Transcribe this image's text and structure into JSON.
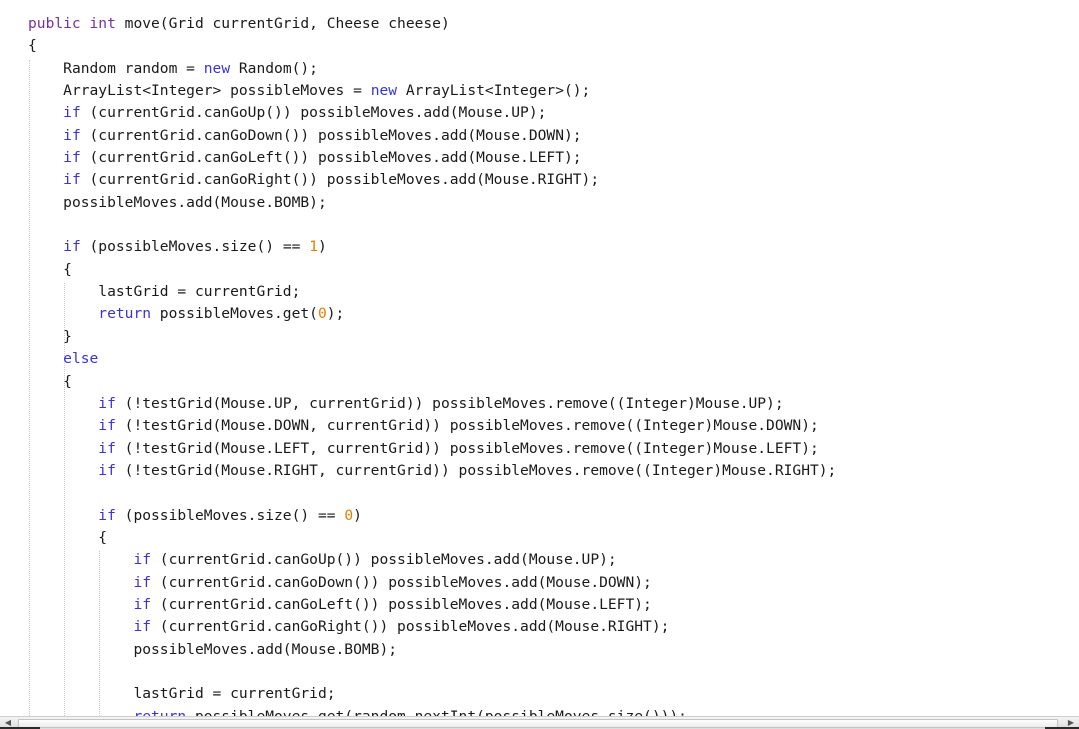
{
  "editor": {
    "language": "java",
    "background_color": "#ffffff",
    "text_color": "#1a1a1a",
    "keyword_color": "#3a34d2",
    "modifier_color": "#7a2fa0",
    "number_color": "#e08000",
    "indent_guide_color": "#c9c9c9",
    "font_size_px": "14.6",
    "line_height_px": "22.35"
  },
  "scrollbar": {
    "orientation": "horizontal",
    "left_arrow": "◀",
    "right_arrow": "▶"
  },
  "code": {
    "lines": [
      {
        "indent": 0,
        "tokens": [
          {
            "t": "public",
            "c": "mod"
          },
          {
            "t": " ",
            "c": "plain"
          },
          {
            "t": "int",
            "c": "mod"
          },
          {
            "t": " move(Grid currentGrid, Cheese cheese)",
            "c": "plain"
          }
        ]
      },
      {
        "indent": 0,
        "tokens": [
          {
            "t": "{",
            "c": "plain"
          }
        ]
      },
      {
        "indent": 1,
        "tokens": [
          {
            "t": "Random random = ",
            "c": "plain"
          },
          {
            "t": "new",
            "c": "kw"
          },
          {
            "t": " Random();",
            "c": "plain"
          }
        ]
      },
      {
        "indent": 1,
        "tokens": [
          {
            "t": "ArrayList<Integer> possibleMoves = ",
            "c": "plain"
          },
          {
            "t": "new",
            "c": "kw"
          },
          {
            "t": " ArrayList<Integer>();",
            "c": "plain"
          }
        ]
      },
      {
        "indent": 1,
        "tokens": [
          {
            "t": "if",
            "c": "kw"
          },
          {
            "t": " (currentGrid.canGoUp()) possibleMoves.add(Mouse.UP);",
            "c": "plain"
          }
        ]
      },
      {
        "indent": 1,
        "tokens": [
          {
            "t": "if",
            "c": "kw"
          },
          {
            "t": " (currentGrid.canGoDown()) possibleMoves.add(Mouse.DOWN);",
            "c": "plain"
          }
        ]
      },
      {
        "indent": 1,
        "tokens": [
          {
            "t": "if",
            "c": "kw"
          },
          {
            "t": " (currentGrid.canGoLeft()) possibleMoves.add(Mouse.LEFT);",
            "c": "plain"
          }
        ]
      },
      {
        "indent": 1,
        "tokens": [
          {
            "t": "if",
            "c": "kw"
          },
          {
            "t": " (currentGrid.canGoRight()) possibleMoves.add(Mouse.RIGHT);",
            "c": "plain"
          }
        ]
      },
      {
        "indent": 1,
        "tokens": [
          {
            "t": "possibleMoves.add(Mouse.BOMB);",
            "c": "plain"
          }
        ]
      },
      {
        "indent": 1,
        "tokens": []
      },
      {
        "indent": 1,
        "tokens": [
          {
            "t": "if",
            "c": "kw"
          },
          {
            "t": " (possibleMoves.size() == ",
            "c": "plain"
          },
          {
            "t": "1",
            "c": "num"
          },
          {
            "t": ")",
            "c": "plain"
          }
        ]
      },
      {
        "indent": 1,
        "tokens": [
          {
            "t": "{",
            "c": "plain"
          }
        ]
      },
      {
        "indent": 2,
        "tokens": [
          {
            "t": "lastGrid = currentGrid;",
            "c": "plain"
          }
        ]
      },
      {
        "indent": 2,
        "tokens": [
          {
            "t": "return",
            "c": "kw"
          },
          {
            "t": " possibleMoves.get(",
            "c": "plain"
          },
          {
            "t": "0",
            "c": "num"
          },
          {
            "t": ");",
            "c": "plain"
          }
        ]
      },
      {
        "indent": 1,
        "tokens": [
          {
            "t": "}",
            "c": "plain"
          }
        ]
      },
      {
        "indent": 1,
        "tokens": [
          {
            "t": "else",
            "c": "kw"
          }
        ]
      },
      {
        "indent": 1,
        "tokens": [
          {
            "t": "{",
            "c": "plain"
          }
        ]
      },
      {
        "indent": 2,
        "tokens": [
          {
            "t": "if",
            "c": "kw"
          },
          {
            "t": " (!testGrid(Mouse.UP, currentGrid)) possibleMoves.remove((Integer)Mouse.UP);",
            "c": "plain"
          }
        ]
      },
      {
        "indent": 2,
        "tokens": [
          {
            "t": "if",
            "c": "kw"
          },
          {
            "t": " (!testGrid(Mouse.DOWN, currentGrid)) possibleMoves.remove((Integer)Mouse.DOWN);",
            "c": "plain"
          }
        ]
      },
      {
        "indent": 2,
        "tokens": [
          {
            "t": "if",
            "c": "kw"
          },
          {
            "t": " (!testGrid(Mouse.LEFT, currentGrid)) possibleMoves.remove((Integer)Mouse.LEFT);",
            "c": "plain"
          }
        ]
      },
      {
        "indent": 2,
        "tokens": [
          {
            "t": "if",
            "c": "kw"
          },
          {
            "t": " (!testGrid(Mouse.RIGHT, currentGrid)) possibleMoves.remove((Integer)Mouse.RIGHT);",
            "c": "plain"
          }
        ]
      },
      {
        "indent": 2,
        "tokens": []
      },
      {
        "indent": 2,
        "tokens": [
          {
            "t": "if",
            "c": "kw"
          },
          {
            "t": " (possibleMoves.size() == ",
            "c": "plain"
          },
          {
            "t": "0",
            "c": "num"
          },
          {
            "t": ")",
            "c": "plain"
          }
        ]
      },
      {
        "indent": 2,
        "tokens": [
          {
            "t": "{",
            "c": "plain"
          }
        ]
      },
      {
        "indent": 3,
        "tokens": [
          {
            "t": "if",
            "c": "kw"
          },
          {
            "t": " (currentGrid.canGoUp()) possibleMoves.add(Mouse.UP);",
            "c": "plain"
          }
        ]
      },
      {
        "indent": 3,
        "tokens": [
          {
            "t": "if",
            "c": "kw"
          },
          {
            "t": " (currentGrid.canGoDown()) possibleMoves.add(Mouse.DOWN);",
            "c": "plain"
          }
        ]
      },
      {
        "indent": 3,
        "tokens": [
          {
            "t": "if",
            "c": "kw"
          },
          {
            "t": " (currentGrid.canGoLeft()) possibleMoves.add(Mouse.LEFT);",
            "c": "plain"
          }
        ]
      },
      {
        "indent": 3,
        "tokens": [
          {
            "t": "if",
            "c": "kw"
          },
          {
            "t": " (currentGrid.canGoRight()) possibleMoves.add(Mouse.RIGHT);",
            "c": "plain"
          }
        ]
      },
      {
        "indent": 3,
        "tokens": [
          {
            "t": "possibleMoves.add(Mouse.BOMB);",
            "c": "plain"
          }
        ]
      },
      {
        "indent": 3,
        "tokens": []
      },
      {
        "indent": 3,
        "tokens": [
          {
            "t": "lastGrid = currentGrid;",
            "c": "plain"
          }
        ]
      },
      {
        "indent": 3,
        "tokens": [
          {
            "t": "return",
            "c": "kw"
          },
          {
            "t": " possibleMoves.get(random.nextInt(possibleMoves.size()));",
            "c": "plain"
          }
        ]
      }
    ]
  }
}
